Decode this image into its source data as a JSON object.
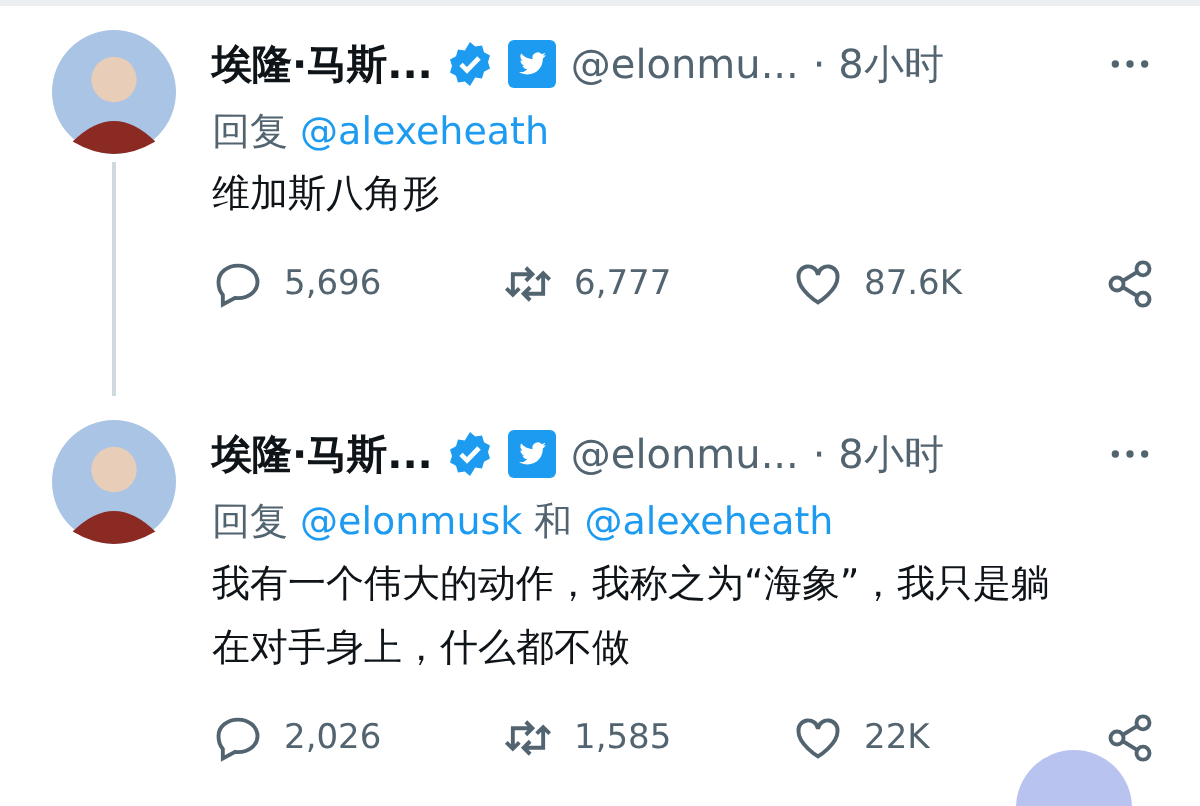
{
  "tweets": [
    {
      "name": "埃隆·马斯...",
      "verified": true,
      "handle": "@elonmu...",
      "time": "· 8小时",
      "thread_line": true,
      "reply": [
        {
          "kind": "text",
          "text": "回复"
        },
        {
          "kind": "mention",
          "text": "@alexeheath"
        }
      ],
      "text": "维加斯八角形",
      "replies": "5,696",
      "retweets": "6,777",
      "likes": "87.6K"
    },
    {
      "name": "埃隆·马斯...",
      "verified": true,
      "handle": "@elonmu...",
      "time": "· 8小时",
      "thread_line": false,
      "reply": [
        {
          "kind": "text",
          "text": "回复"
        },
        {
          "kind": "mention",
          "text": "@elonmusk"
        },
        {
          "kind": "text",
          "text": "和"
        },
        {
          "kind": "mention",
          "text": "@alexeheath"
        }
      ],
      "text": "我有一个伟大的动作，我称之为“海象”，我只是躺在对手身上，什么都不做",
      "replies": "2,026",
      "retweets": "1,585",
      "likes": "22K"
    }
  ]
}
